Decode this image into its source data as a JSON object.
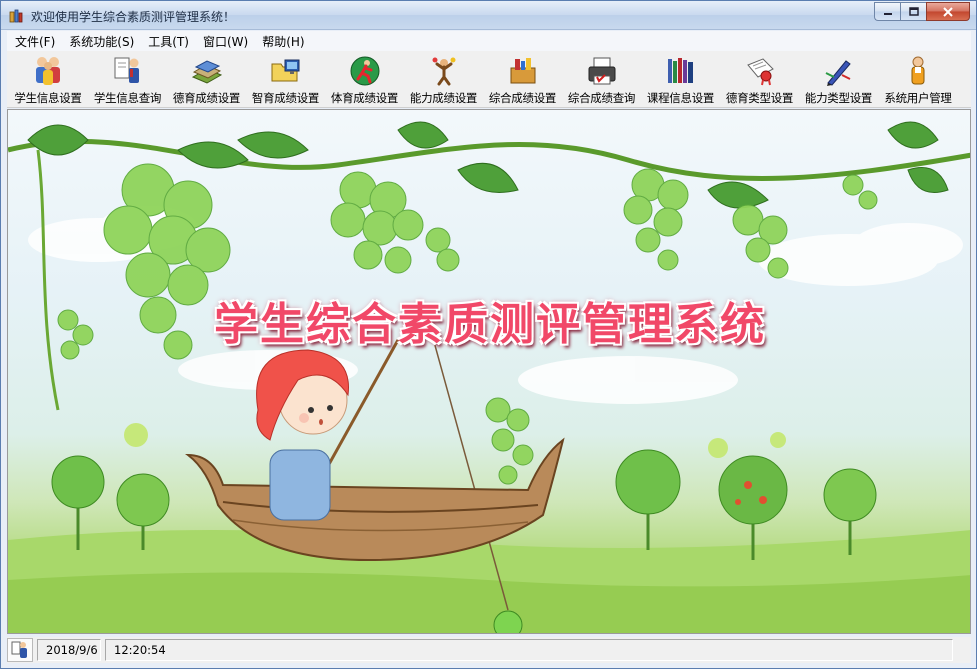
{
  "window": {
    "title": "欢迎使用学生综合素质测评管理系统！"
  },
  "menu": [
    {
      "label": "文件(F)"
    },
    {
      "label": "系统功能(S)"
    },
    {
      "label": "工具(T)"
    },
    {
      "label": "窗口(W)"
    },
    {
      "label": "帮助(H)"
    }
  ],
  "toolbar": [
    {
      "label": "学生信息设置",
      "icon": "people-icon"
    },
    {
      "label": "学生信息查询",
      "icon": "teacher-icon"
    },
    {
      "label": "德育成绩设置",
      "icon": "books-icon"
    },
    {
      "label": "智育成绩设置",
      "icon": "folder-computer-icon"
    },
    {
      "label": "体育成绩设置",
      "icon": "runner-icon"
    },
    {
      "label": "能力成绩设置",
      "icon": "juggler-icon"
    },
    {
      "label": "综合成绩设置",
      "icon": "toolbox-icon"
    },
    {
      "label": "综合成绩查询",
      "icon": "printer-icon"
    },
    {
      "label": "课程信息设置",
      "icon": "bookshelf-icon"
    },
    {
      "label": "德育类型设置",
      "icon": "certificate-icon"
    },
    {
      "label": "能力类型设置",
      "icon": "pen-icon"
    },
    {
      "label": "系统用户管理",
      "icon": "user-icon"
    }
  ],
  "main": {
    "banner_text": "学生综合素质测评管理系统"
  },
  "status": {
    "date": "2018/9/6",
    "time": "12:20:54"
  },
  "colors": {
    "banner": "#f14868",
    "sky": "#e6f2f7",
    "grass": "#a5d46c",
    "grape": "#8fd45a"
  }
}
